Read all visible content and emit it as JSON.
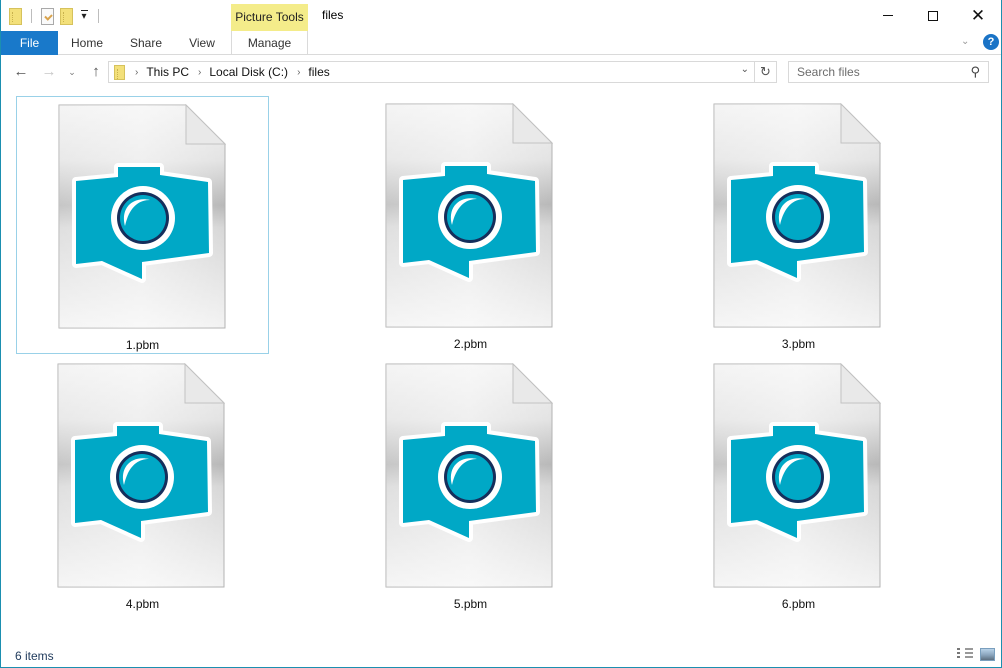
{
  "titlebar": {
    "title": "files",
    "contextual_tab_group": "Picture Tools",
    "quick_access": [
      "folder-icon",
      "properties-icon",
      "new-folder-icon",
      "customize-dropdown"
    ],
    "window_controls": {
      "minimize": "minimize",
      "maximize": "maximize",
      "close": "close"
    }
  },
  "ribbon": {
    "tabs": [
      {
        "label": "File",
        "active": true
      },
      {
        "label": "Home"
      },
      {
        "label": "Share"
      },
      {
        "label": "View"
      },
      {
        "label": "Manage"
      }
    ],
    "help_label": "?"
  },
  "navigation": {
    "back_icon": "←",
    "forward_icon": "→",
    "recent_icon": "⌄",
    "up_icon": "↑",
    "breadcrumb": [
      "This PC",
      "Local Disk (C:)",
      "files"
    ],
    "refresh_icon": "↻",
    "search": {
      "placeholder": "Search files",
      "value": ""
    }
  },
  "files": [
    {
      "name": "1.pbm",
      "selected": true
    },
    {
      "name": "2.pbm"
    },
    {
      "name": "3.pbm"
    },
    {
      "name": "4.pbm"
    },
    {
      "name": "5.pbm"
    },
    {
      "name": "6.pbm"
    }
  ],
  "colors": {
    "accent": "#1979ca",
    "context_tab": "#f4ec8a",
    "camera": "#00a8c6",
    "lens_ring": "#152f5c",
    "selection_border": "#99d1e8"
  },
  "statusbar": {
    "item_count": "6 items"
  }
}
